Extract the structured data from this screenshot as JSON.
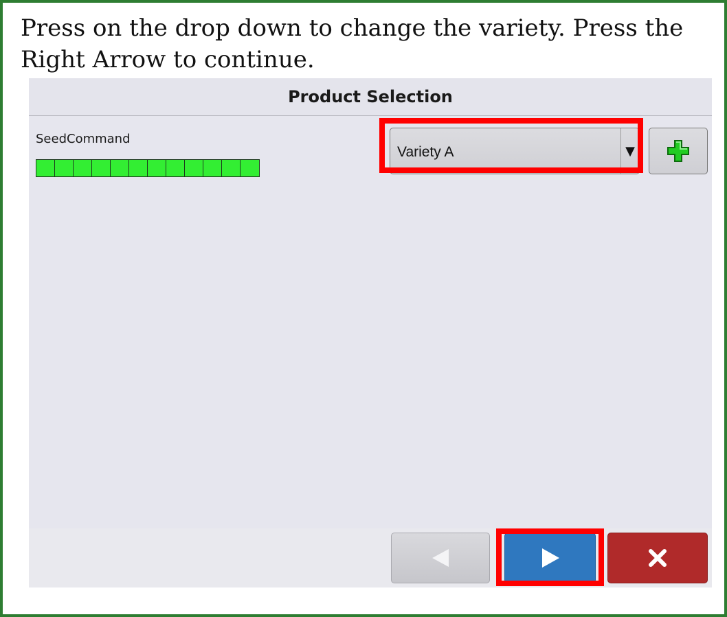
{
  "instructions": "Press on the drop down to change the variety. Press the Right Arrow to continue.",
  "header": {
    "title": "Product Selection"
  },
  "product": {
    "label": "SeedCommand",
    "row_count": 12,
    "row_color": "#33ee33"
  },
  "dropdown": {
    "selected_value": "Variety A",
    "arrow_icon": "triangle-down-icon"
  },
  "add_button": {
    "icon": "plus-icon",
    "color": "#22cc22"
  },
  "footer": {
    "back_icon": "left-arrow-icon",
    "next_icon": "right-arrow-icon",
    "cancel_icon": "close-icon",
    "next_color": "#2f78bf",
    "cancel_color": "#b02a2a"
  },
  "highlight_color": "#ff0000"
}
